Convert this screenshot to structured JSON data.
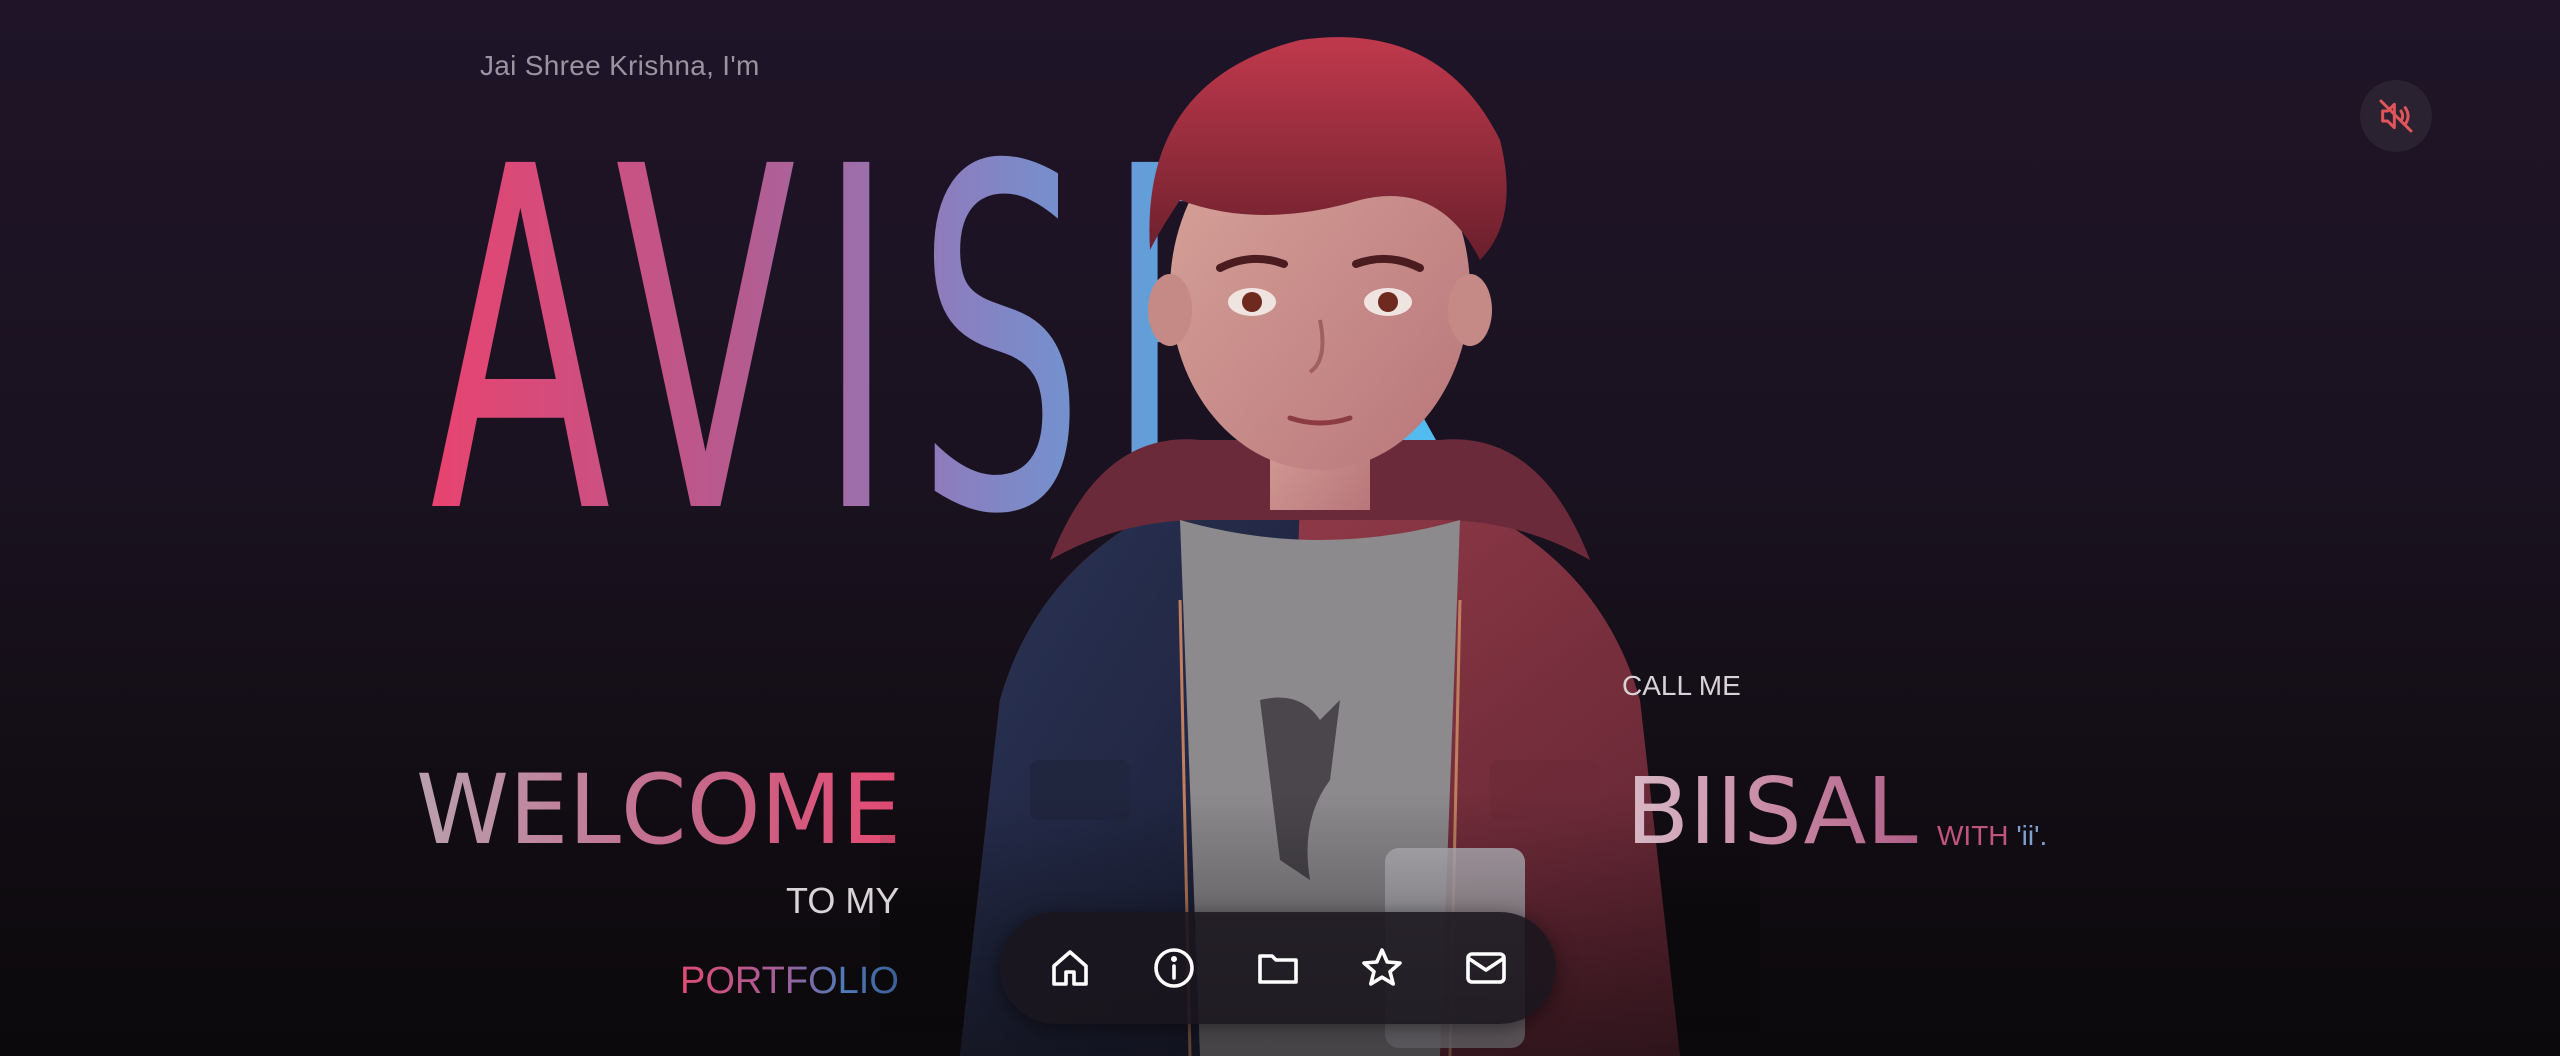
{
  "hero": {
    "greeting": "Jai Shree Krishna, I'm",
    "name": "AVISEK"
  },
  "intro": {
    "welcome": "WELCOME",
    "to_my": "TO MY",
    "portfolio": "PORTFOLIO"
  },
  "nickname": {
    "call_me": "CALL ME",
    "name": "BIISAL",
    "with_prefix": "WITH ",
    "with_suffix": "'ii'."
  },
  "controls": {
    "sound_icon": "volume-muted-icon",
    "sound_icon_color": "#e0555a"
  },
  "dock": {
    "items": [
      {
        "icon": "home-icon"
      },
      {
        "icon": "info-icon"
      },
      {
        "icon": "folder-icon"
      },
      {
        "icon": "star-icon"
      },
      {
        "icon": "mail-icon"
      }
    ]
  },
  "colors": {
    "name_gradient_start": "#e8436f",
    "name_gradient_end": "#4fc2f5",
    "background": "#1a1220"
  }
}
